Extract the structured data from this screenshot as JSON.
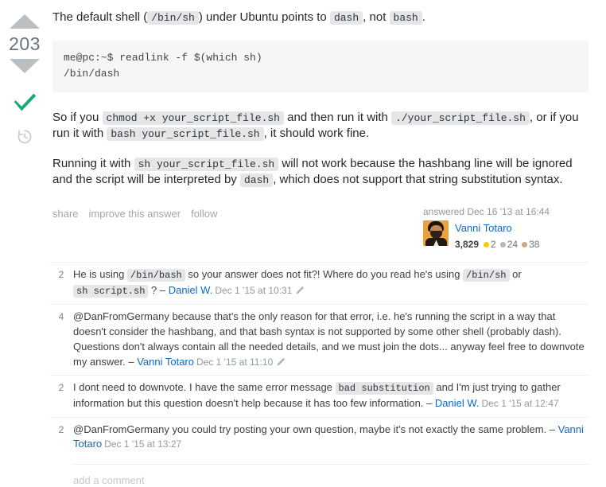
{
  "vote": {
    "score": "203",
    "up_title": "up-vote",
    "down_title": "down-vote",
    "accepted_title": "accepted-answer",
    "history_title": "post-history"
  },
  "post": {
    "paragraph1": {
      "part1": "The default shell (",
      "code1": "/bin/sh",
      "part2": ") under Ubuntu points to ",
      "code2": "dash",
      "part3": ", not ",
      "code3": "bash",
      "part4": "."
    },
    "code_block": "me@pc:~$ readlink -f $(which sh)\n/bin/dash",
    "paragraph2": {
      "part1": "So if you ",
      "code1": "chmod +x your_script_file.sh",
      "part2": " and then run it with ",
      "code2": "./your_script_file.sh",
      "part3": ", or if you run it with ",
      "code3": "bash your_script_file.sh",
      "part4": ", it should work fine."
    },
    "paragraph3": {
      "part1": "Running it with ",
      "code1": "sh your_script_file.sh",
      "part2": " will not work because the hashbang line will be ignored and the script will be interpreted by ",
      "code2": "dash",
      "part3": ", which does not support that string substitution syntax."
    }
  },
  "post_menu": {
    "share": "share",
    "improve": "improve this answer",
    "follow": "follow"
  },
  "user_card": {
    "action_time": "answered Dec 16 '13 at 16:44",
    "name": "Vanni Totaro",
    "reputation": "3,829",
    "gold": "2",
    "silver": "24",
    "bronze": "38",
    "gold_color": "#ffcc01",
    "silver_color": "#b4b8bc",
    "bronze_color": "#d1a684"
  },
  "comments": [
    {
      "score": "2",
      "parts": [
        {
          "type": "text",
          "value": "He is using "
        },
        {
          "type": "code",
          "value": "/bin/bash"
        },
        {
          "type": "text",
          "value": " so your answer does not fit?! Where do you read he's using "
        },
        {
          "type": "code",
          "value": "/bin/sh"
        },
        {
          "type": "text",
          "value": " or "
        },
        {
          "type": "code",
          "value": "sh script.sh"
        },
        {
          "type": "text",
          "value": " ? – "
        }
      ],
      "user": "Daniel W.",
      "date": "Dec 1 '15 at 10:31",
      "has_edit_icon": true
    },
    {
      "score": "4",
      "parts": [
        {
          "type": "text",
          "value": "@DanFromGermany because that's the only reason for that error, i.e. he's running the script in a way that doesn't consider the hashbang, and that bash syntax is not supported by some other shell (probably dash). Questions don't always contain all the needed details, and we must join the dots... anyway feel free to downvote my answer. – "
        }
      ],
      "user": "Vanni Totaro",
      "date": "Dec 1 '15 at 11:10",
      "has_edit_icon": true
    },
    {
      "score": "2",
      "parts": [
        {
          "type": "text",
          "value": "I dont need to downvote. I have the same error message "
        },
        {
          "type": "code",
          "value": "bad substitution"
        },
        {
          "type": "text",
          "value": " and I'm just trying to gather information but this question doesn't help because it has too few information. – "
        }
      ],
      "user": "Daniel W.",
      "date": "Dec 1 '15 at 12:47",
      "has_edit_icon": false
    },
    {
      "score": "2",
      "parts": [
        {
          "type": "text",
          "value": "@DanFromGermany you could try posting your own question, maybe it's not exactly the same problem. – "
        }
      ],
      "user": "Vanni Totaro",
      "date": "Dec 1 '15 at 13:27",
      "has_edit_icon": false
    }
  ],
  "add_comment": "add a comment"
}
